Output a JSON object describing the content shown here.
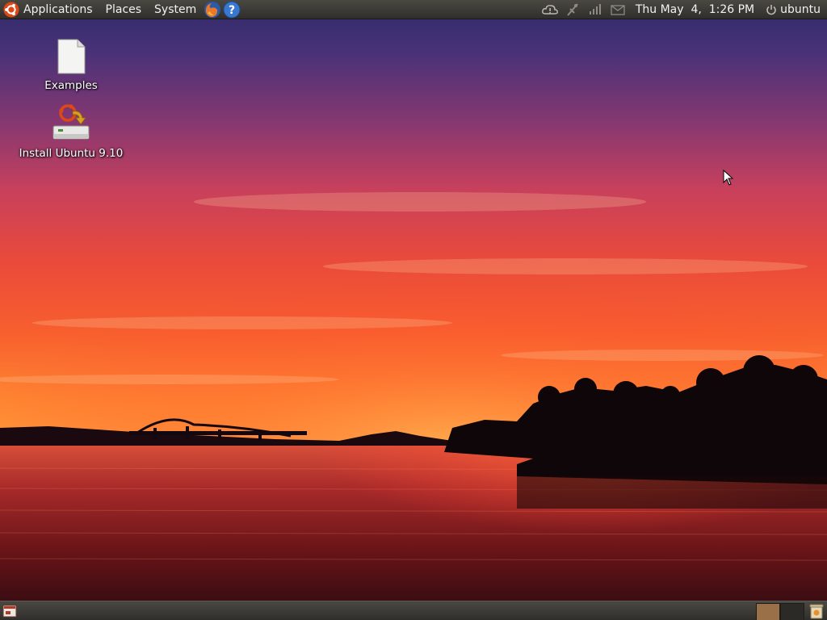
{
  "top_panel": {
    "menus": [
      {
        "label": "Applications"
      },
      {
        "label": "Places"
      },
      {
        "label": "System"
      }
    ],
    "launchers": [
      "firefox-icon",
      "help-icon"
    ],
    "tray_icons": [
      "update-notifier-icon",
      "network-icon",
      "volume-icon",
      "mail-icon"
    ],
    "clock": "Thu May  4,  1:26 PM",
    "user": "ubuntu"
  },
  "desktop_icons": [
    {
      "label": "Examples",
      "icon": "document-icon"
    },
    {
      "label": "Install Ubuntu 9.10",
      "icon": "installer-icon"
    }
  ],
  "bottom_panel": {
    "workspaces": 2,
    "active_workspace": 1
  },
  "colors": {
    "panel": "#3a3935",
    "sky_top": "#3b2d6b",
    "sky_mid": "#c2405a",
    "horizon": "#ff7a2a",
    "water": "#7a1a1a",
    "workspace_active": "#9a7048"
  }
}
